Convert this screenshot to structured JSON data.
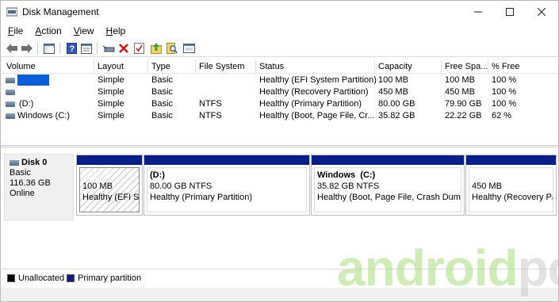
{
  "window": {
    "title": "Disk Management"
  },
  "menu": [
    {
      "label": "File",
      "accel": "F",
      "rest": "ile"
    },
    {
      "label": "Action",
      "accel": "A",
      "rest": "ction"
    },
    {
      "label": "View",
      "accel": "V",
      "rest": "iew"
    },
    {
      "label": "Help",
      "accel": "H",
      "rest": "elp"
    }
  ],
  "toolbar_icons": [
    "back-arrow-icon",
    "forward-arrow-icon",
    "show-hide-console-tree-icon",
    "help-icon",
    "properties-icon",
    "connect-icon",
    "delete-icon",
    "check-icon",
    "export-icon",
    "search-icon",
    "console-icon"
  ],
  "table": {
    "columns": [
      "Volume",
      "Layout",
      "Type",
      "File System",
      "Status",
      "Capacity",
      "Free Spa...",
      "% Free"
    ],
    "rows": [
      {
        "volume": "",
        "layout": "Simple",
        "type": "Basic",
        "fs": "",
        "status": "Healthy (EFI System Partition)",
        "capacity": "100 MB",
        "free": "100 MB",
        "pct": "100 %"
      },
      {
        "volume": "",
        "layout": "Simple",
        "type": "Basic",
        "fs": "",
        "status": "Healthy (Recovery Partition)",
        "capacity": "450 MB",
        "free": "450 MB",
        "pct": "100 %"
      },
      {
        "volume": "(D:)",
        "layout": "Simple",
        "type": "Basic",
        "fs": "NTFS",
        "status": "Healthy (Primary Partition)",
        "capacity": "80.00 GB",
        "free": "79.90 GB",
        "pct": "100 %"
      },
      {
        "volume": "Windows (C:)",
        "layout": "Simple",
        "type": "Basic",
        "fs": "NTFS",
        "status": "Healthy (Boot, Page File, Cr...",
        "capacity": "35.82 GB",
        "free": "22.22 GB",
        "pct": "62 %"
      }
    ]
  },
  "disk": {
    "name": "Disk 0",
    "type": "Basic",
    "size": "116.36 GB",
    "state": "Online",
    "partitions": [
      {
        "name": "",
        "size": "100 MB",
        "status": "Healthy (EFI Sys"
      },
      {
        "name": "(D:)",
        "size": "80.00 GB NTFS",
        "status": "Healthy (Primary Partition)"
      },
      {
        "name": "Windows  (C:)",
        "size": "35.82 GB NTFS",
        "status": "Healthy (Boot, Page File, Crash Dump,"
      },
      {
        "name": "",
        "size": "450 MB",
        "status": "Healthy (Recovery Par"
      }
    ]
  },
  "legend": [
    {
      "label": "Unallocated",
      "color": "#000000"
    },
    {
      "label": "Primary partition",
      "color": "#0a1e8a"
    }
  ],
  "watermark": {
    "a": "android",
    "b": "pc"
  },
  "colors": {
    "partition_bar": "#0a1e8a",
    "selection_highlight": "#0a5fd8"
  }
}
